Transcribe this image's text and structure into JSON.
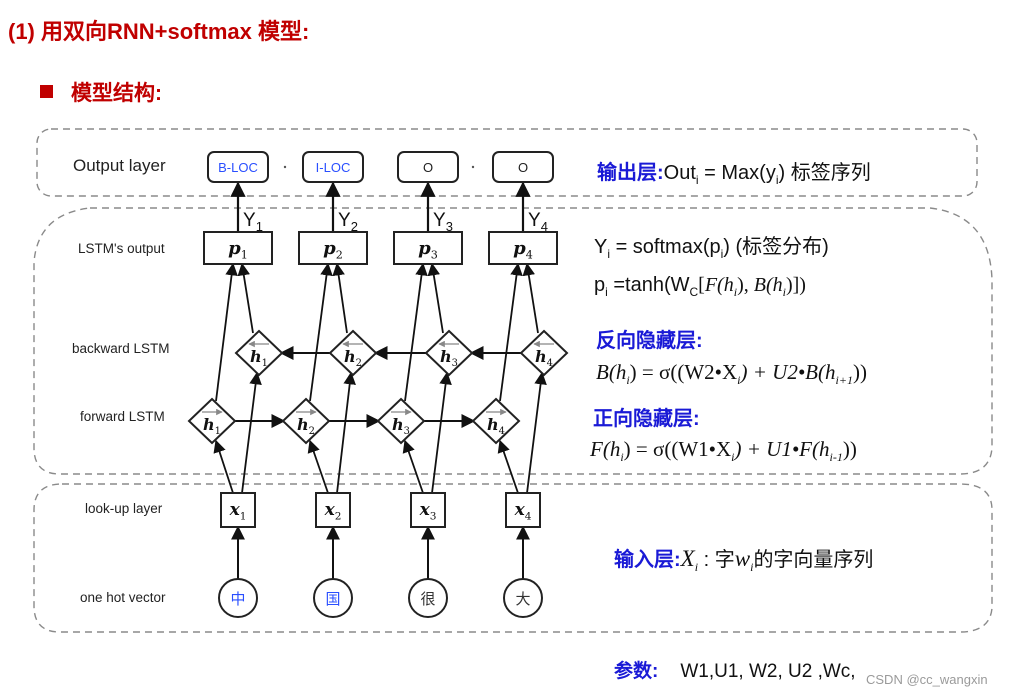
{
  "heading": {
    "title": "(1) 用双向RNN+softmax 模型:",
    "subtitle": "模型结构:"
  },
  "diagram": {
    "layer_labels": {
      "output": "Output layer",
      "lstm_output": "LSTM's output",
      "backward": "backward LSTM",
      "forward": "forward LSTM",
      "lookup": "look-up layer",
      "onehot": "one hot vector"
    },
    "output_tags": [
      "B-LOC",
      "I-LOC",
      "O",
      "O"
    ],
    "y_labels": [
      {
        "base": "Y",
        "sub": "1"
      },
      {
        "base": "Y",
        "sub": "2"
      },
      {
        "base": "Y",
        "sub": "3"
      },
      {
        "base": "Y",
        "sub": "4"
      }
    ],
    "p_nodes": [
      {
        "base": "p",
        "sub": "1"
      },
      {
        "base": "p",
        "sub": "2"
      },
      {
        "base": "p",
        "sub": "3"
      },
      {
        "base": "p",
        "sub": "4"
      }
    ],
    "backward_nodes": [
      {
        "base": "h",
        "sub": "1"
      },
      {
        "base": "h",
        "sub": "2"
      },
      {
        "base": "h",
        "sub": "3"
      },
      {
        "base": "h",
        "sub": "4"
      }
    ],
    "forward_nodes": [
      {
        "base": "h",
        "sub": "1"
      },
      {
        "base": "h",
        "sub": "2"
      },
      {
        "base": "h",
        "sub": "3"
      },
      {
        "base": "h",
        "sub": "4"
      }
    ],
    "x_nodes": [
      {
        "base": "x",
        "sub": "1"
      },
      {
        "base": "x",
        "sub": "2"
      },
      {
        "base": "x",
        "sub": "3"
      },
      {
        "base": "x",
        "sub": "4"
      }
    ],
    "chars": [
      {
        "text": "中",
        "color": "#2a4fff"
      },
      {
        "text": "国",
        "color": "#2a4fff"
      },
      {
        "text": "很",
        "color": "#333333"
      },
      {
        "text": "大",
        "color": "#333333"
      }
    ],
    "tag_colors": {
      "entity": "#2a4fff",
      "other": "#222222"
    }
  },
  "annotations": {
    "output_layer": {
      "label": "输出层:",
      "expr_pre": "Out",
      "expr_sub1": "i",
      "expr_mid": " = Max(y",
      "expr_sub2": "i",
      "expr_post": ")  标签序列"
    },
    "softmax": {
      "pre": "Y",
      "sub1": "i",
      "mid": " = softmax(p",
      "sub2": "i",
      "post": ") (标签分布)"
    },
    "tanh": {
      "pre": "p",
      "sub1": "i",
      "mid": " =tanh(W",
      "sub2": "C",
      "bracket": "[",
      "f": "F(h",
      "fsub": "i",
      "comma": "), ",
      "b": "B(h",
      "bsub": "i",
      "post": ")])"
    },
    "backward_hidden": {
      "label": "反向隐藏层:",
      "formula_lhs": "B(h",
      "lhs_sub": "i",
      "formula_mid": ") = σ((W2•X",
      "mid_sub": "i",
      "formula_mid2": ") + U2•B(h",
      "rhs_sub": "i+1",
      "formula_end": "))"
    },
    "forward_hidden": {
      "label": "正向隐藏层:",
      "formula_lhs": "F(h",
      "lhs_sub": "i",
      "formula_mid": ") = σ((W1•X",
      "mid_sub": "i",
      "formula_mid2": ") + U1•F(h",
      "rhs_sub": "i-1",
      "formula_end": "))"
    },
    "input_layer": {
      "label": "输入层:",
      "x": "X",
      "x_sub": "i",
      "colon": " :  字",
      "w": "w",
      "w_sub": "i",
      "post": "的字向量序列"
    },
    "params": {
      "label": "参数:",
      "value": "W1,U1, W2, U2 ,Wc,"
    }
  },
  "watermark": "CSDN @cc_wangxin"
}
